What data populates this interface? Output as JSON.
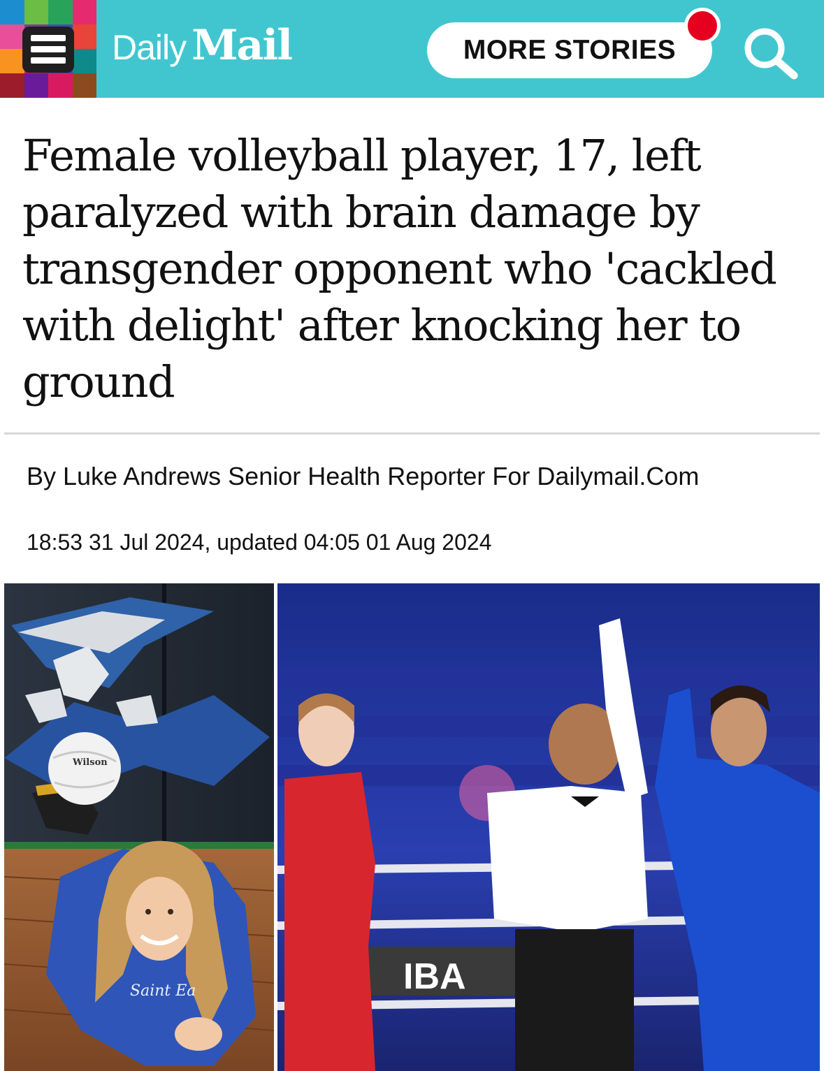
{
  "header": {
    "brand_daily": "Daily",
    "brand_mail": "Mail",
    "more_stories_label": "MORE STORIES",
    "background_color": "#41c6cf",
    "mosaic_colors": [
      "#1c8ed0",
      "#6bbd45",
      "#2aa35a",
      "#e52a6f",
      "#e94e9a",
      "#7e3a96",
      "#3a4fb5",
      "#e8443a",
      "#f7931e",
      "#c2185b",
      "#5b3c9e",
      "#0f8a8a",
      "#9c1c2c",
      "#6a1b9a",
      "#d81b60",
      "#8d4a1f"
    ],
    "icons": [
      "hamburger-menu-icon",
      "notification-dot",
      "search-icon"
    ]
  },
  "article": {
    "headline": "Female volleyball player, 17, left paralyzed with brain damage by transgender opponent who 'cackled with delight' after knocking her to ground",
    "byline": "By Luke Andrews Senior Health Reporter For Dailymail.Com",
    "dateline": "18:53 31 Jul 2024, updated 04:05 01 Aug 2024"
  },
  "photos": {
    "left": {
      "ball_brand": "Wilson",
      "jersey_text": "Saint Ea"
    },
    "right": {
      "banner_logo": "IBA"
    }
  }
}
